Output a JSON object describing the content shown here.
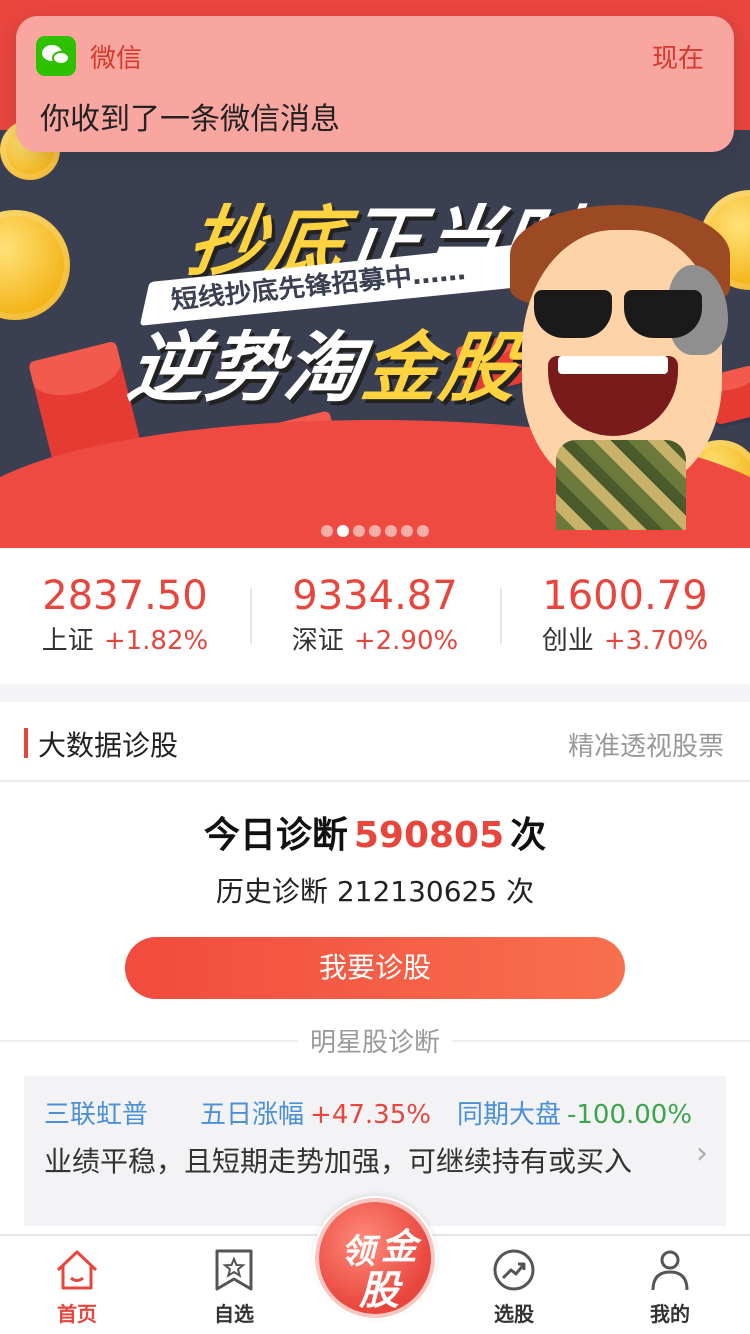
{
  "notification": {
    "app_name": "微信",
    "time": "现在",
    "message": "你收到了一条微信消息",
    "icon": "wechat-icon"
  },
  "banner": {
    "headline_line1_gold": "抄底",
    "headline_line1_white": "正当时",
    "slogan": "短线抄底先锋招募中……",
    "headline_line2_white": "逆势淘",
    "headline_line2_gold": "金股",
    "page_count": 7,
    "active_page": 1
  },
  "indices": [
    {
      "value": "2837.50",
      "name": "上证",
      "change": "+1.82%"
    },
    {
      "value": "9334.87",
      "name": "深证",
      "change": "+2.90%"
    },
    {
      "value": "1600.79",
      "name": "创业",
      "change": "+3.70%"
    }
  ],
  "section": {
    "title": "大数据诊股",
    "subtitle": "精准透视股票"
  },
  "diagnosis": {
    "today_prefix": "今日诊断",
    "today_count": "590805",
    "today_suffix": "次",
    "history_prefix": "历史诊断",
    "history_count": "212130625",
    "history_suffix": "次",
    "cta": "我要诊股"
  },
  "star_divider": "明星股诊断",
  "star_stock": {
    "name": "三联虹普",
    "period_label": "五日涨幅",
    "period_change": "+47.35%",
    "market_label": "同期大盘",
    "market_change": "-100.00%",
    "comment": "业绩平稳，且短期走势加强，可继续持有或买入"
  },
  "tabbar": {
    "home": "首页",
    "watchlist": "自选",
    "center_chars": [
      "领",
      "金",
      "股"
    ],
    "picker": "选股",
    "mine": "我的"
  },
  "colors": {
    "accent": "#e8453c",
    "blue": "#4a90d9",
    "green": "#3aa54a"
  }
}
